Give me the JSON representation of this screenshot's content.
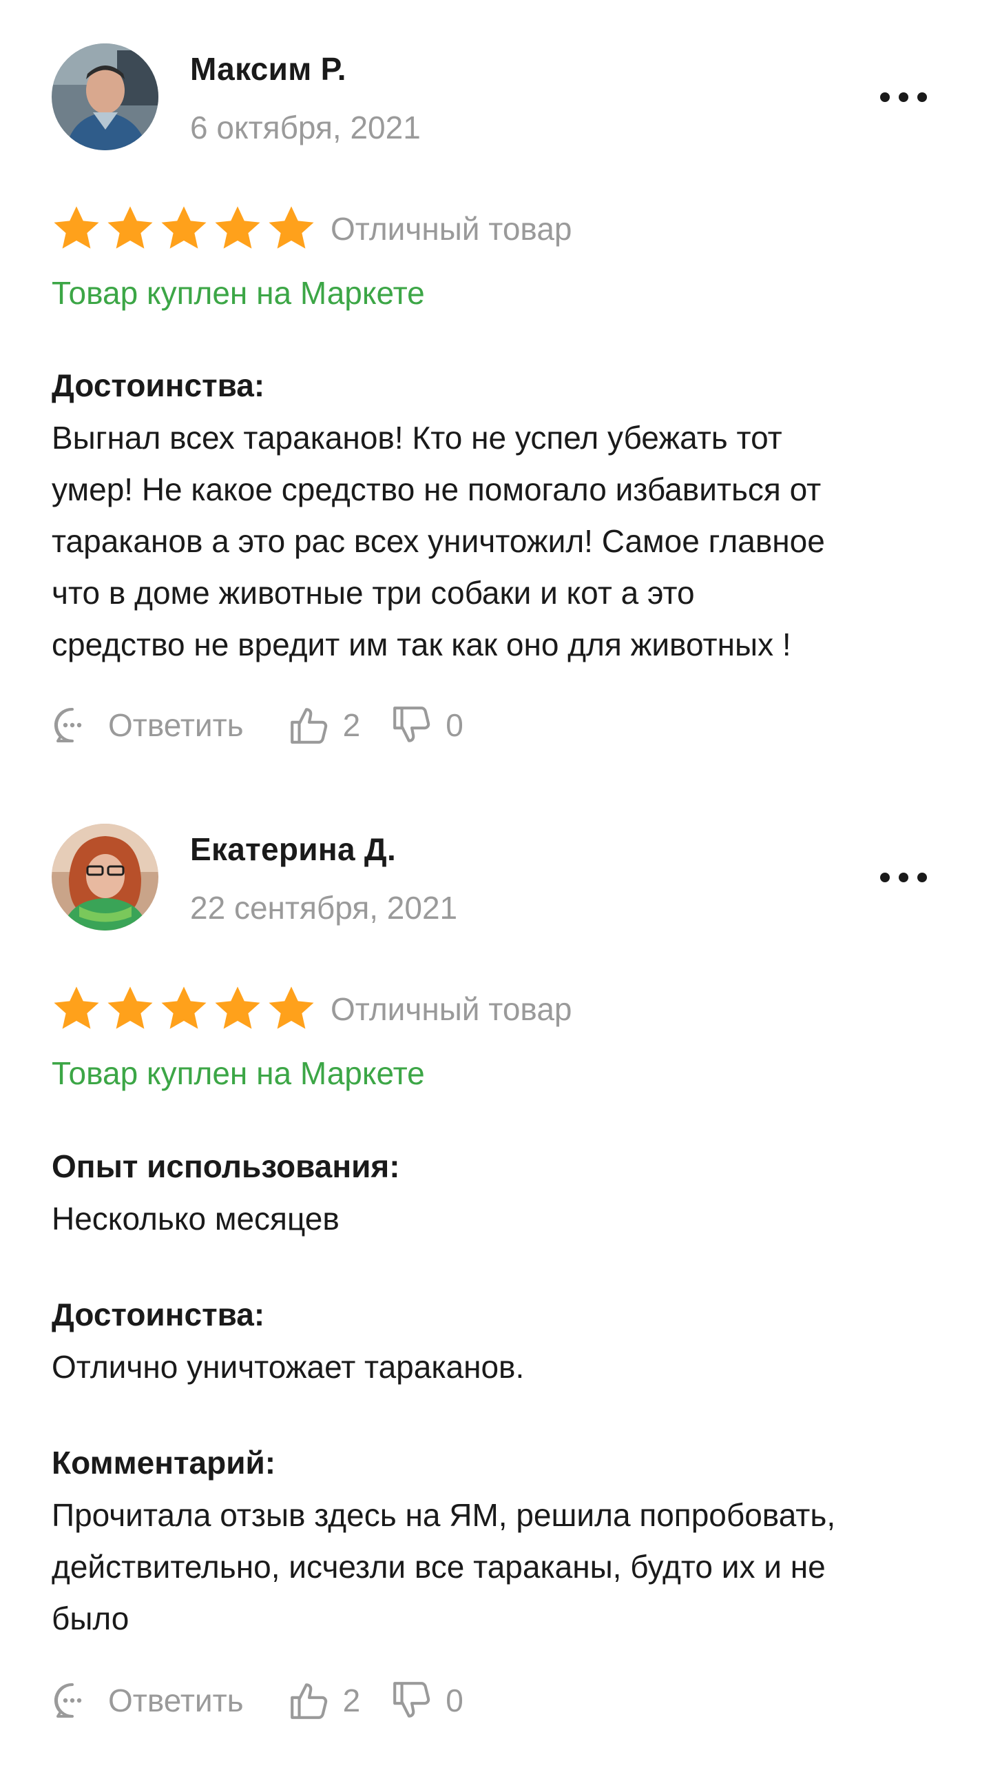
{
  "colors": {
    "star": "#ffa11b",
    "bought": "#3ca646",
    "muted": "#9a9a9a",
    "text": "#1a1a1a"
  },
  "reviews": [
    {
      "author": "Максим Р.",
      "date": "6 октября, 2021",
      "rating": 5,
      "rating_text": "Отличный товар",
      "bought": "Товар куплен на Маркете",
      "sections": [
        {
          "title": "Достоинства:",
          "lines": [
            "Выгнал всех тараканов! Кто не успел убежать тот",
            "умер! Не какое средство не помогало избавиться от",
            "тараканов а это рас всех уничтожил! Самое главное",
            "что в доме животные три собаки и кот а это",
            "средство не вредит им так как оно для животных !"
          ]
        }
      ],
      "actions": {
        "reply": "Ответить",
        "likes": "2",
        "dislikes": "0"
      }
    },
    {
      "author": "Екатерина Д.",
      "date": "22 сентября, 2021",
      "rating": 5,
      "rating_text": "Отличный товар",
      "bought": "Товар куплен на Маркете",
      "sections": [
        {
          "title": "Опыт использования:",
          "lines": [
            "Несколько месяцев"
          ]
        },
        {
          "title": "Достоинства:",
          "lines": [
            "Отлично уничтожает тараканов."
          ]
        },
        {
          "title": "Комментарий:",
          "lines": [
            "Прочитала отзыв здесь на ЯМ, решила попробовать,",
            "действительно, исчезли все тараканы, будто их и не",
            "было"
          ]
        }
      ],
      "actions": {
        "reply": "Ответить",
        "likes": "2",
        "dislikes": "0"
      }
    }
  ]
}
